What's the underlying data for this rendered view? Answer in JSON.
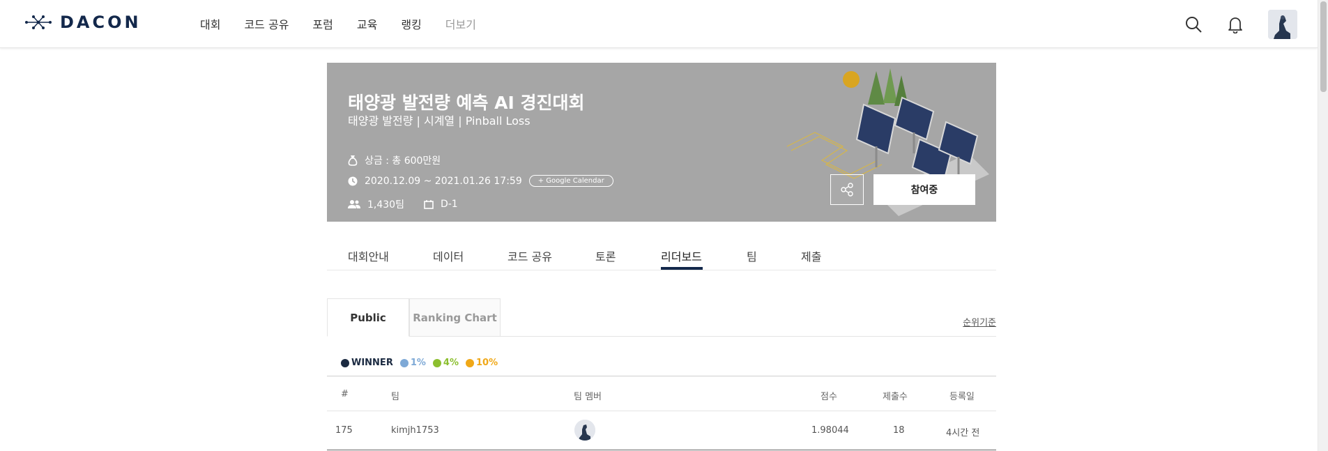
{
  "header": {
    "logo_text": "DACON",
    "nav": [
      "대회",
      "코드 공유",
      "포럼",
      "교육",
      "랭킹",
      "더보기"
    ],
    "icons": [
      "search-icon",
      "bell-icon"
    ]
  },
  "banner": {
    "title": "태양광 발전량 예측 AI 경진대회",
    "subtitle": "태양광 발전량 | 시계열 | Pinball Loss",
    "prize": "상금 : 총 600만원",
    "period": "2020.12.09 ~ 2021.01.26 17:59",
    "calendar_button": "+ Google Calendar",
    "teams": "1,430팀",
    "dday": "D-1",
    "join_button": "참여중",
    "bg_color": "#a6a6a6"
  },
  "tabs": {
    "items": [
      "대회안내",
      "데이터",
      "코드 공유",
      "토론",
      "리더보드",
      "팀",
      "제출"
    ],
    "active": "리더보드"
  },
  "subtabs": {
    "public": "Public",
    "ranking_chart": "Ranking Chart",
    "ranking_criteria": "순위기준"
  },
  "legend": [
    {
      "label": "WINNER",
      "color": "#1b2a41"
    },
    {
      "label": "1%",
      "color": "#7ea9d6"
    },
    {
      "label": "4%",
      "color": "#8cbf2f"
    },
    {
      "label": "10%",
      "color": "#f0a818"
    }
  ],
  "table": {
    "columns": [
      "#",
      "팀",
      "팀 멤버",
      "점수",
      "제출수",
      "등록일"
    ],
    "rows": [
      {
        "rank": "175",
        "team": "kimjh1753",
        "score": "1.98044",
        "submissions": "18",
        "date": "4시간 전"
      }
    ]
  }
}
